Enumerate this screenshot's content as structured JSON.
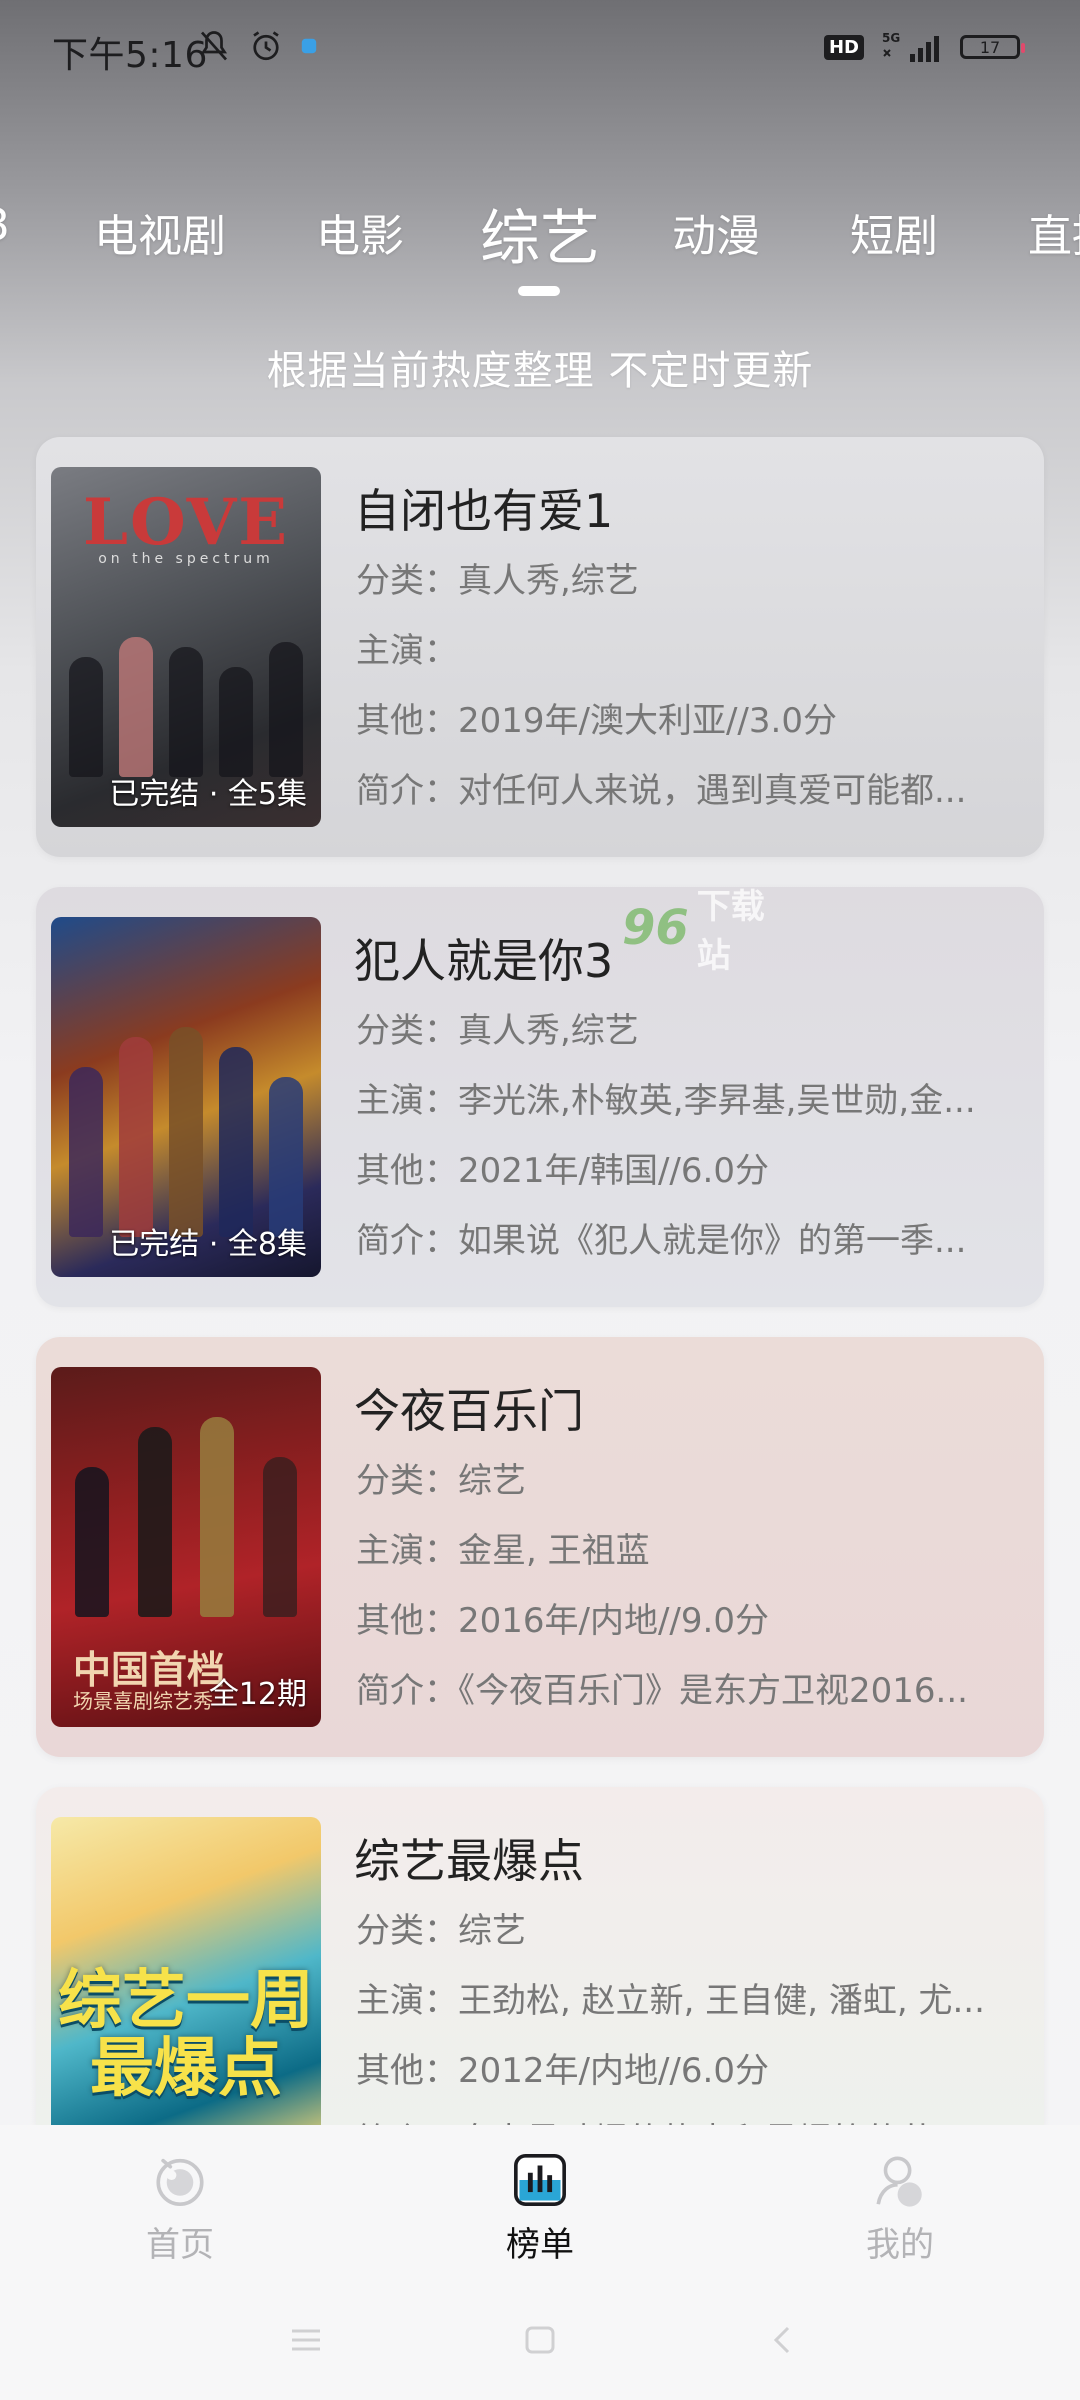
{
  "status_bar": {
    "time": "下午5:16",
    "network": "5G",
    "battery": "17",
    "hd_label": "HD"
  },
  "tabs": {
    "items": [
      {
        "label": "电视剧"
      },
      {
        "label": "电影"
      },
      {
        "label": "综艺",
        "active": true
      },
      {
        "label": "动漫"
      },
      {
        "label": "短剧"
      },
      {
        "label": "直播"
      }
    ]
  },
  "subtitle": "根据当前热度整理 不定时更新",
  "cards": [
    {
      "title": "自闭也有爱1",
      "category": "分类：真人秀,综艺",
      "cast": "主演：",
      "other": "其他：2019年/澳大利亚//3.0分",
      "intro": "简介：对任何人来说，遇到真爱可能都...",
      "badge": "已完结 · 全5集",
      "poster_art": {
        "title": "LOVE",
        "sub": "on the spectrum"
      }
    },
    {
      "title": "犯人就是你3",
      "category": "分类：真人秀,综艺",
      "cast": "主演：李光洙,朴敏英,李昇基,吴世勋,金...",
      "other": "其他：2021年/韩国//6.0分",
      "intro": "简介：如果说《犯人就是你》的第一季...",
      "badge": "已完结 · 全8集"
    },
    {
      "title": "今夜百乐门",
      "category": "分类：综艺",
      "cast": "主演：金星, 王祖蓝",
      "other": "其他：2016年/内地//9.0分",
      "intro": "简介：《今夜百乐门》是东方卫视2016...",
      "badge": "全12期",
      "poster_art": {
        "cn": "中国首档",
        "cn_sub": "场景喜剧综艺秀"
      }
    },
    {
      "title": "综艺最爆点",
      "category": "分类：综艺",
      "cast": "主演：王劲松, 赵立新, 王自健, 潘虹, 尤...",
      "other": "其他：2012年/内地//6.0分",
      "intro": "简介：盘点最劲爆的热点和最爆笑的节...",
      "poster_art": {
        "big": "综艺一周\n最爆点"
      }
    }
  ],
  "watermark": {
    "nums": "96",
    "text": "下载站"
  },
  "bottom_nav": {
    "home": "首页",
    "rank": "榜单",
    "mine": "我的"
  },
  "colors": {
    "active_nav": "#111111",
    "inactive_nav": "#b3b3b6",
    "rank_icon": "#2aa6d6"
  }
}
